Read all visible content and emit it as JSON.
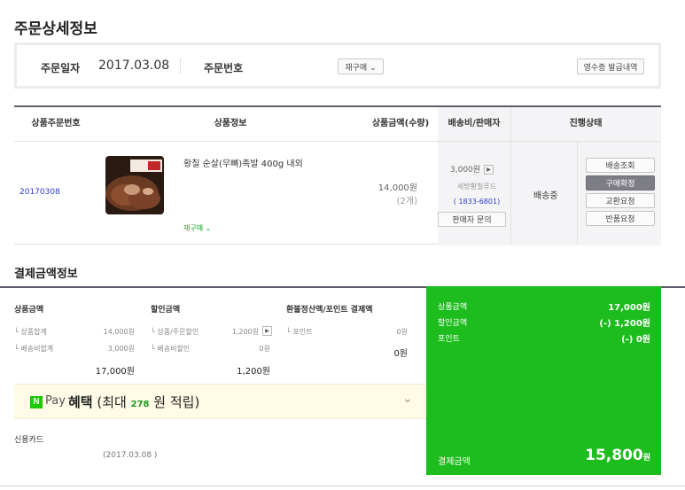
{
  "page_title": "주문상세정보",
  "order_info": {
    "date_label": "주문일자",
    "date_value": "2017.03.08",
    "number_label": "주문번호",
    "rebuy_button": "재구매 ⌄",
    "receipt_button": "영수증 발급내역"
  },
  "product_table": {
    "headers": [
      "상품주문번호",
      "상품정보",
      "상품금액(수량)",
      "배송비/판매자",
      "진행상태"
    ],
    "row": {
      "order_no": "20170308",
      "product_name": "황칠 순살(무뼈)족발 400g 내외",
      "rebuy_link": "재구매 ⌄",
      "price": "14,000원",
      "quantity": "(2개)",
      "shipping_fee": "3,000원",
      "seller": "세방황칠푸드",
      "seller_phone": "( 1833-6801)",
      "seller_inquiry_button": "판매자 문의",
      "status": "배송중",
      "actions": [
        "배송조회",
        "구매확정",
        "교환요청",
        "반품요청"
      ]
    }
  },
  "payment": {
    "section_title": "결제금액정보",
    "product_amount": {
      "title": "상품금액",
      "rows": [
        {
          "label": "└ 상품합계",
          "value": "14,000원"
        },
        {
          "label": "└ 배송비합계",
          "value": "3,000원"
        }
      ],
      "total": "17,000원"
    },
    "discount": {
      "title": "할인금액",
      "rows": [
        {
          "label": "└ 상품/주문할인",
          "value": "1,200원"
        },
        {
          "label": "└ 배송비할인",
          "value": "0원"
        }
      ],
      "total": "1,200원"
    },
    "refund": {
      "title": "환불정산액/포인트 결제액",
      "rows": [
        {
          "label": "└ 포인트",
          "value": "0원"
        }
      ],
      "total": "0원"
    },
    "summary": {
      "product_label": "상품금액",
      "product_value": "17,000원",
      "discount_label": "할인금액",
      "discount_value": "(-) 1,200원",
      "point_label": "포인트",
      "point_value": "(-) 0원",
      "total_label": "결제금액",
      "total_value": "15,800",
      "total_unit": "원"
    },
    "npay": {
      "logo": "N",
      "pay_word": "Pay",
      "benefit": "혜택",
      "prefix": "(최대",
      "amount": "278",
      "suffix": "원 적립)"
    },
    "method_label": "신용카드",
    "method_date": "(2017.03.08        )"
  },
  "colors": {
    "accent_green": "#1ebd1e",
    "link_blue": "#2b3cc7",
    "header_border": "#5e5e6a"
  }
}
